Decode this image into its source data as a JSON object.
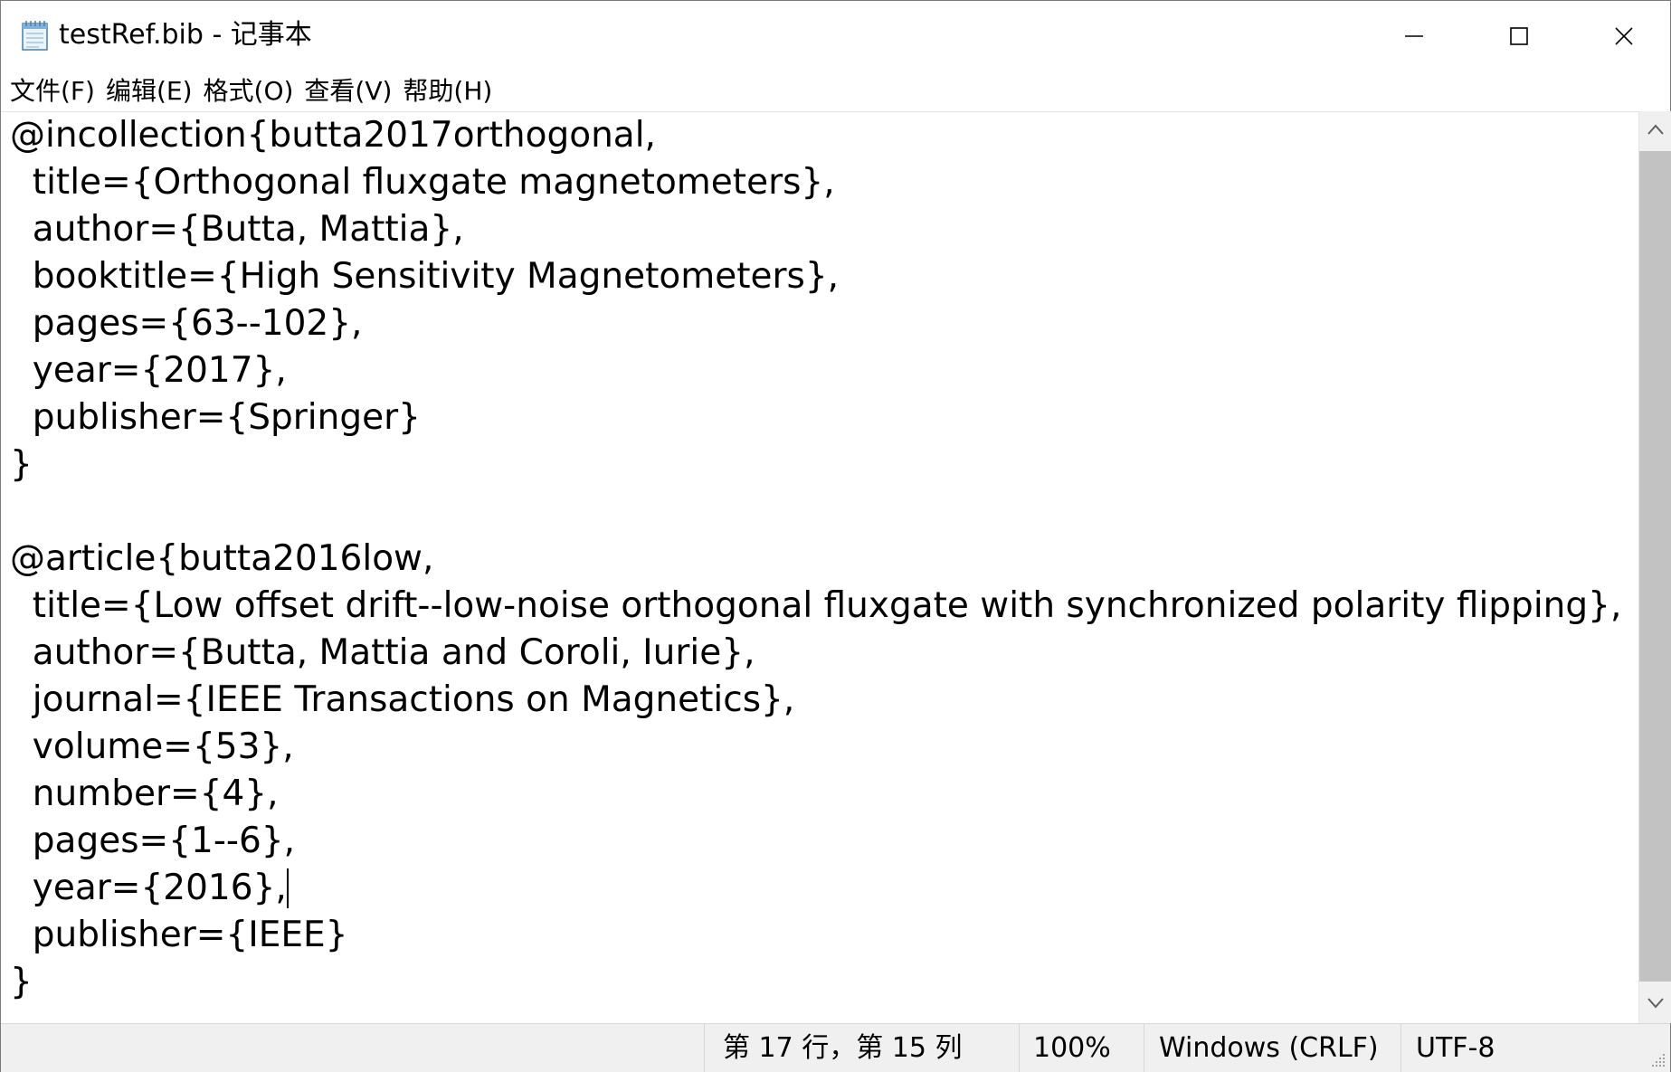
{
  "window": {
    "title": "testRef.bib - 记事本",
    "app_icon": "notepad-icon",
    "controls": {
      "minimize": "minimize-icon",
      "maximize": "maximize-icon",
      "close": "close-icon"
    }
  },
  "menu": {
    "items": [
      {
        "label": "文件(F)"
      },
      {
        "label": "编辑(E)"
      },
      {
        "label": "格式(O)"
      },
      {
        "label": "查看(V)"
      },
      {
        "label": "帮助(H)"
      }
    ]
  },
  "editor": {
    "content": "@incollection{butta2017orthogonal,\n  title={Orthogonal fluxgate magnetometers},\n  author={Butta, Mattia},\n  booktitle={High Sensitivity Magnetometers},\n  pages={63--102},\n  year={2017},\n  publisher={Springer}\n}\n\n@article{butta2016low,\n  title={Low offset drift--low-noise orthogonal fluxgate with synchronized polarity flipping},\n  author={Butta, Mattia and Coroli, Iurie},\n  journal={IEEE Transactions on Magnetics},\n  volume={53},\n  number={4},\n  pages={1--6},\n  year={2016},\n  publisher={IEEE}\n}",
    "caret_line": 17,
    "caret_column": 15
  },
  "status": {
    "position": "第 17 行，第 15 列",
    "zoom": "100%",
    "line_ending": "Windows (CRLF)",
    "encoding": "UTF-8"
  },
  "colors": {
    "scrollbar_track": "#f0f0f0",
    "scrollbar_thumb": "#c2c2c2",
    "statusbar_bg": "#f0f0f0",
    "text": "#000000"
  }
}
